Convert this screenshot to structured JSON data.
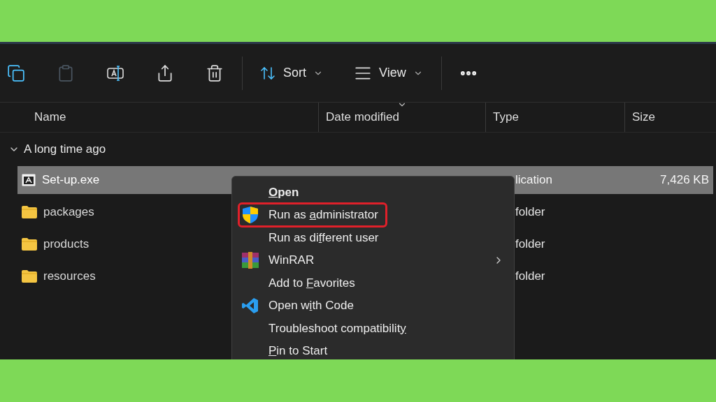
{
  "toolbar": {
    "actions": [
      {
        "kind": "copy",
        "disabled": false
      },
      {
        "kind": "paste",
        "disabled": true
      },
      {
        "kind": "rename",
        "disabled": false
      },
      {
        "kind": "share",
        "disabled": false
      },
      {
        "kind": "delete",
        "disabled": false
      }
    ],
    "sort": {
      "label": "Sort"
    },
    "view": {
      "label": "View"
    }
  },
  "columns": [
    {
      "label": "Name",
      "sorted": false
    },
    {
      "label": "Date modified",
      "sorted": true
    },
    {
      "label": "Type",
      "sorted": false
    },
    {
      "label": "Size",
      "sorted": false
    }
  ],
  "group": {
    "label": "A long time ago",
    "expanded": true
  },
  "rows": [
    {
      "name": "Set-up.exe",
      "kind": "application",
      "type": "lication",
      "size": "7,426 KB",
      "selected": true
    },
    {
      "name": "packages",
      "kind": "folder",
      "type": "folder",
      "selected": false
    },
    {
      "name": "products",
      "kind": "folder",
      "type": "folder",
      "selected": false
    },
    {
      "name": "resources",
      "kind": "folder",
      "type": "folder",
      "selected": false
    }
  ],
  "context_menu": {
    "items": [
      {
        "key": "O",
        "after": "pen",
        "default": true,
        "highlighted": false,
        "has_submenu": false
      },
      {
        "before": "Run as ",
        "key": "a",
        "after": "dministrator",
        "kind": "admin",
        "default": false,
        "highlighted": true,
        "has_submenu": false
      },
      {
        "before": "Run as di",
        "key": "f",
        "after": "ferent user",
        "default": false,
        "highlighted": false,
        "has_submenu": false
      },
      {
        "before": "WinRAR",
        "kind": "archiver",
        "default": false,
        "highlighted": false,
        "has_submenu": true
      },
      {
        "before": "Add to ",
        "key": "F",
        "after": "avorites",
        "default": false,
        "highlighted": false,
        "has_submenu": false
      },
      {
        "before": "Open w",
        "key": "i",
        "after": "th Code",
        "kind": "editor",
        "default": false,
        "highlighted": false,
        "has_submenu": false
      },
      {
        "before": "Troubleshoot compatibilit",
        "key": "y",
        "default": false,
        "highlighted": false,
        "has_submenu": false
      },
      {
        "key": "P",
        "after": "in to Start",
        "default": false,
        "highlighted": false,
        "has_submenu": false
      }
    ]
  }
}
